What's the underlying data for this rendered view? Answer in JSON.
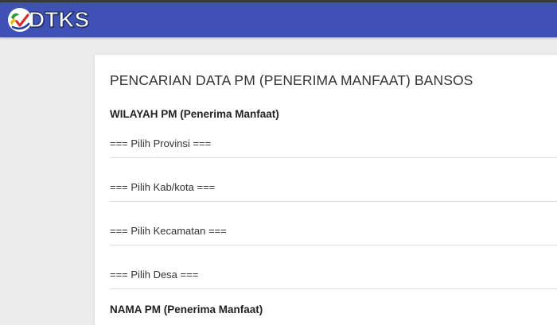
{
  "header": {
    "logo_text": "DTKS",
    "logo_icon": "dtks-logo-icon",
    "bar_color": "#3f51b5"
  },
  "main": {
    "title": "PENCARIAN DATA PM (PENERIMA MANFAAT) BANSOS",
    "wilayah_label": "WILAYAH PM (Penerima Manfaat)",
    "provinsi": "=== Pilih Provinsi ===",
    "kabkota": "=== Pilih Kab/kota ===",
    "kecamatan": "=== Pilih Kecamatan ===",
    "desa": "=== Pilih Desa ===",
    "nama_label": "NAMA PM (Penerima Manfaat)"
  }
}
